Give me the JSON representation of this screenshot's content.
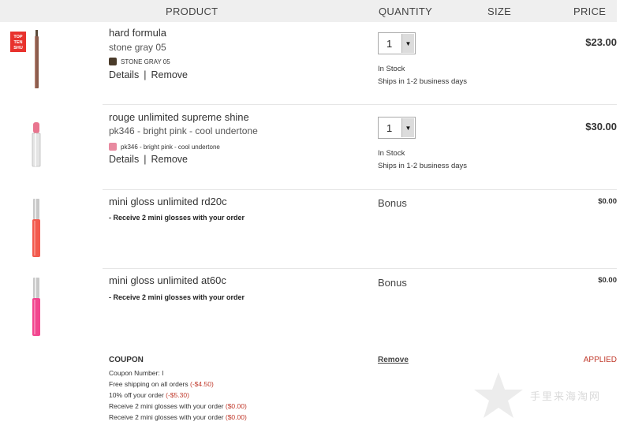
{
  "header": {
    "product": "PRODUCT",
    "quantity": "QUANTITY",
    "size": "SIZE",
    "price": "PRICE"
  },
  "items": [
    {
      "name": "hard formula",
      "variant": "stone gray 05",
      "swatch_label": "STONE GRAY 05",
      "swatch_color": "#4a3b2a",
      "details": "Details",
      "remove": "Remove",
      "quantity": "1",
      "stock": "In Stock",
      "ships": "Ships in 1-2 business days",
      "price": "$23.00",
      "brand_badge": "TOP TEN SHU"
    },
    {
      "name": "rouge unlimited supreme shine",
      "variant": "pk346 - bright pink - cool undertone",
      "swatch_label": "pk346 - bright pink - cool undertone",
      "swatch_color": "#e88aa0",
      "details": "Details",
      "remove": "Remove",
      "quantity": "1",
      "stock": "In Stock",
      "ships": "Ships in 1-2 business days",
      "price": "$30.00"
    },
    {
      "name": "mini gloss unlimited rd20c",
      "note": "- Receive 2 mini glosses with your order",
      "qty_label": "Bonus",
      "price": "$0.00",
      "gloss_color": "#f25a4e"
    },
    {
      "name": "mini gloss unlimited at60c",
      "note": "- Receive 2 mini glosses with your order",
      "qty_label": "Bonus",
      "price": "$0.00",
      "gloss_color": "#f2468f"
    }
  ],
  "coupon": {
    "title": "COUPON",
    "number_label": "Coupon Number: I",
    "lines": [
      {
        "text": "Free shipping on all orders ",
        "amount": "(-$4.50)"
      },
      {
        "text": "10% off your order ",
        "amount": "(-$5.30)"
      },
      {
        "text": "Receive 2 mini glosses with your order ",
        "amount": "($0.00)"
      },
      {
        "text": "Receive 2 mini glosses with your order ",
        "amount": "($0.00)"
      }
    ],
    "remove": "Remove",
    "status": "APPLIED"
  },
  "watermark": "手里来海淘网"
}
